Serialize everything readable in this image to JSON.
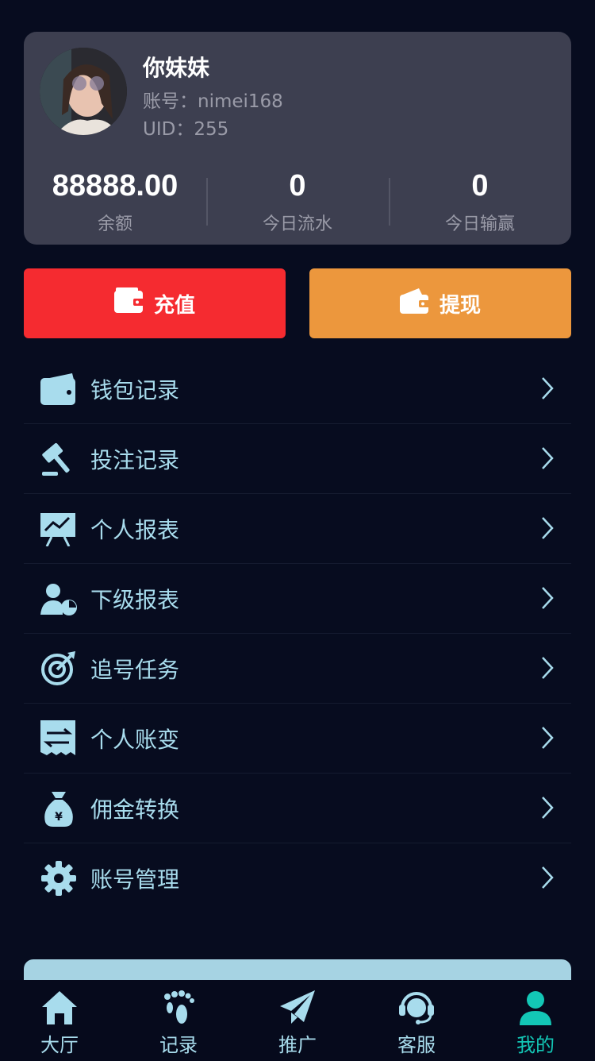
{
  "profile": {
    "username": "你妹妹",
    "account": "账号：nimei168",
    "uid": "UID：255"
  },
  "stats": [
    {
      "value": "88888.00",
      "label": "余额"
    },
    {
      "value": "0",
      "label": "今日流水"
    },
    {
      "value": "0",
      "label": "今日输赢"
    }
  ],
  "actions": {
    "recharge_label": "充值",
    "withdraw_label": "提现",
    "recharge_color": "#f52b30",
    "withdraw_color": "#ec973d"
  },
  "menu": [
    {
      "label": "钱包记录",
      "icon": "wallet-icon"
    },
    {
      "label": "投注记录",
      "icon": "gavel-icon"
    },
    {
      "label": "个人报表",
      "icon": "presentation-chart-icon"
    },
    {
      "label": "下级报表",
      "icon": "user-pie-icon"
    },
    {
      "label": "追号任务",
      "icon": "target-icon"
    },
    {
      "label": "个人账变",
      "icon": "receipt-transfer-icon"
    },
    {
      "label": "佣金转换",
      "icon": "money-bag-icon"
    },
    {
      "label": "账号管理",
      "icon": "gear-icon"
    }
  ],
  "tabbar": [
    {
      "label": "大厅",
      "icon": "home-icon"
    },
    {
      "label": "记录",
      "icon": "footprints-icon"
    },
    {
      "label": "推广",
      "icon": "paper-plane-icon"
    },
    {
      "label": "客服",
      "icon": "headset-icon"
    },
    {
      "label": "我的",
      "icon": "user-icon",
      "active": true
    }
  ],
  "colors": {
    "background": "#070c1f",
    "card": "#3d3f50",
    "menu_text": "#a8dced",
    "active_tab": "#13c7b6"
  }
}
